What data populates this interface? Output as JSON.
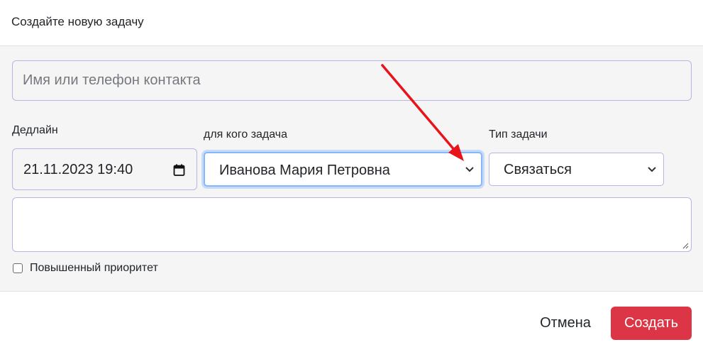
{
  "header": {
    "title": "Создайте новую задачу"
  },
  "form": {
    "contact_placeholder": "Имя или телефон контакта",
    "deadline_label": "Дедлайн",
    "deadline_value": "21.11.2023 19:40",
    "assignee_label": "для кого задача",
    "assignee_selected": "Иванова Мария Петровна",
    "task_type_label": "Тип задачи",
    "task_type_selected": "Связаться",
    "note_value": "",
    "priority_label": "Повышенный приоритет",
    "priority_checked": false
  },
  "footer": {
    "cancel_label": "Отмена",
    "create_label": "Создать"
  },
  "colors": {
    "primary_danger": "#dc3545",
    "annotation_arrow": "#e8141b",
    "focus_border": "#86b7fe"
  },
  "icons": {
    "date_picker": "calendar-icon",
    "dropdown": "chevron-down-icon",
    "annotation": "red-arrow"
  }
}
